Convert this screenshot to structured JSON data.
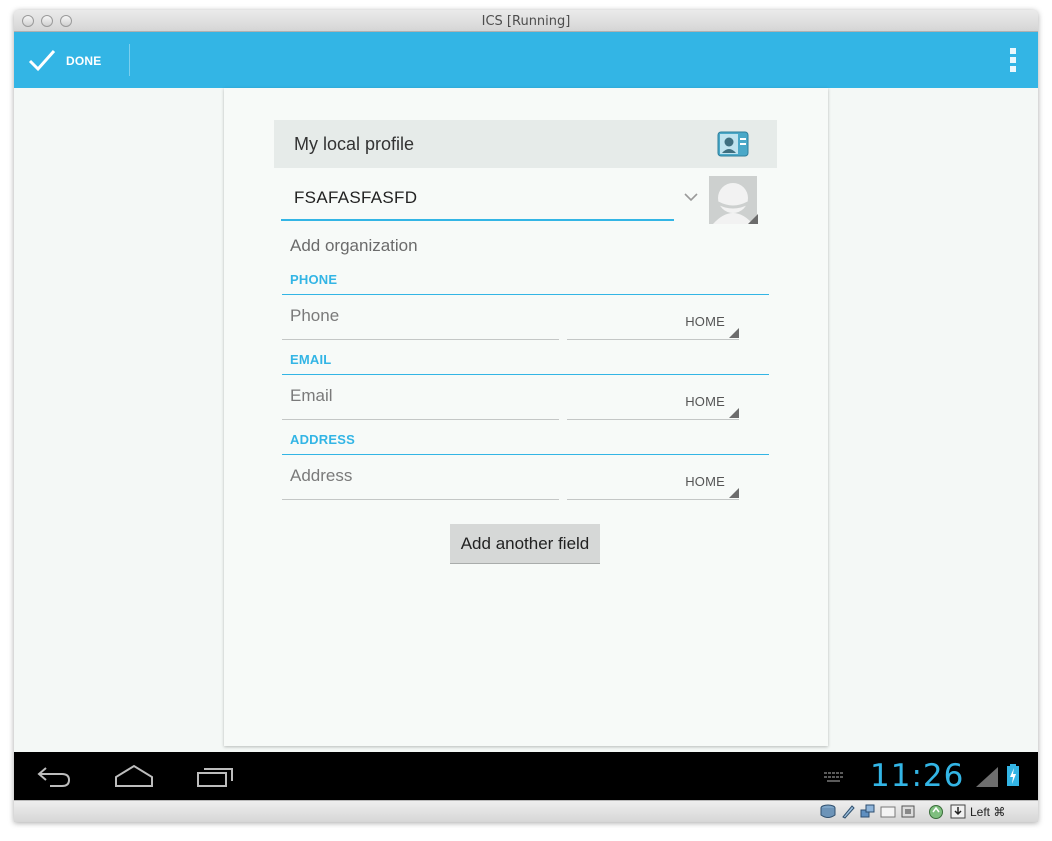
{
  "window": {
    "title": "ICS [Running]"
  },
  "action_bar": {
    "done_label": "DONE",
    "accent": "#33b5e5"
  },
  "editor": {
    "account_label": "My local profile",
    "name_value": "FSAFASFASFD",
    "add_organization": "Add organization",
    "sections": [
      {
        "title": "PHONE",
        "placeholder": "Phone",
        "type": "HOME"
      },
      {
        "title": "EMAIL",
        "placeholder": "Email",
        "type": "HOME"
      },
      {
        "title": "ADDRESS",
        "placeholder": "Address",
        "type": "HOME"
      }
    ],
    "add_field_label": "Add another field"
  },
  "navbar": {
    "clock": "11:26"
  },
  "statusbar": {
    "host_key": "Left ⌘"
  },
  "icons": {
    "done": "check-icon",
    "menu": "overflow-menu-icon",
    "account": "contact-card-icon",
    "photo": "person-silhouette-icon",
    "nav": [
      "back-icon",
      "home-icon",
      "recent-apps-icon"
    ]
  }
}
